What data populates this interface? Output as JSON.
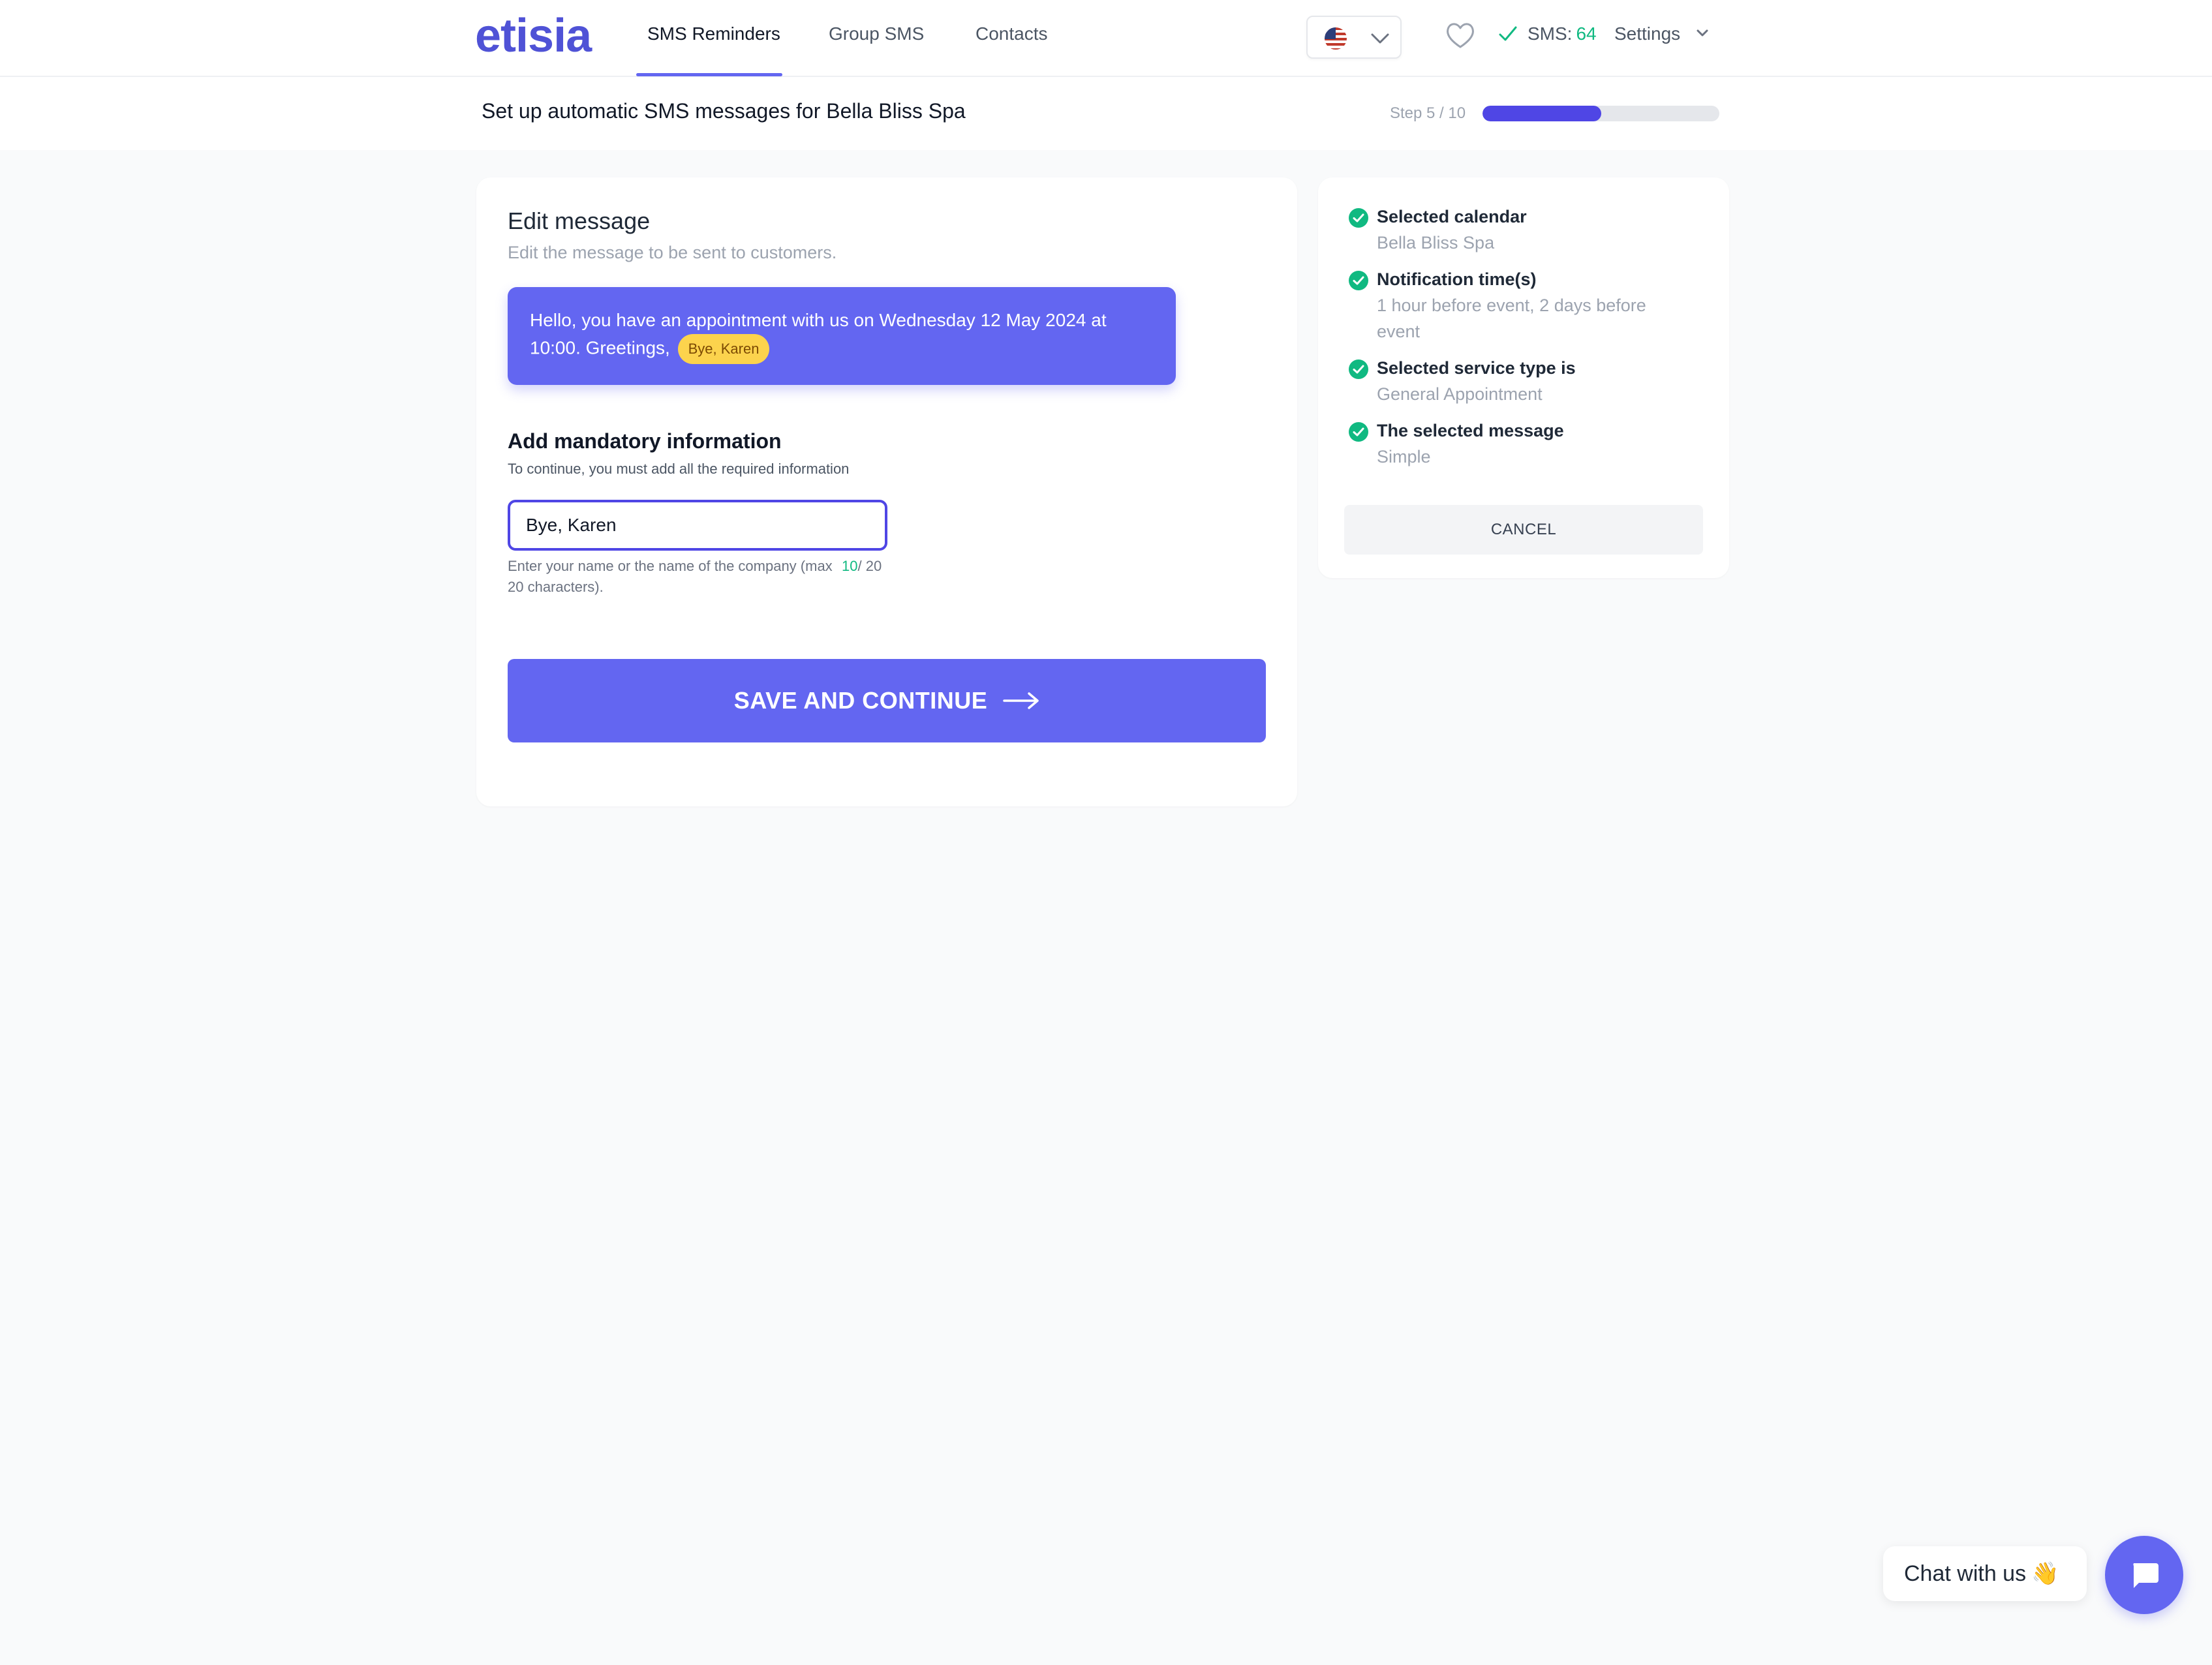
{
  "header": {
    "logo": "etisia",
    "tabs": [
      {
        "label": "SMS Reminders",
        "active": true
      },
      {
        "label": "Group SMS",
        "active": false
      },
      {
        "label": "Contacts",
        "active": false
      }
    ],
    "language_icon": "us-flag-icon",
    "sms_label": "SMS:",
    "sms_count": "64",
    "settings_label": "Settings"
  },
  "subheader": {
    "title": "Set up automatic SMS messages for Bella Bliss Spa",
    "step_label": "Step 5 / 10",
    "progress": 0.5
  },
  "editor": {
    "title": "Edit message",
    "subtitle": "Edit the message to be sent to customers.",
    "preview_text": "Hello, you have an appointment with us on Wednesday 12 May 2024 at 10:00. Greetings,",
    "preview_tag": "Bye, Karen",
    "mandatory_title": "Add mandatory information",
    "mandatory_subtitle": "To continue, you must add all the required information",
    "input_value": "Bye, Karen",
    "input_help": "Enter your name or the name of the company (max 20 characters).",
    "char_current": "10",
    "char_max": "/ 20",
    "save_label": "SAVE AND CONTINUE"
  },
  "summary": {
    "items": [
      {
        "label": "Selected calendar",
        "value": "Bella Bliss Spa"
      },
      {
        "label": "Notification time(s)",
        "value": "1 hour before event, 2 days before event"
      },
      {
        "label": "Selected service type is",
        "value": "General Appointment"
      },
      {
        "label": "The selected message",
        "value": "Simple"
      }
    ],
    "cancel_label": "CANCEL"
  },
  "chat": {
    "label": "Chat with us",
    "emoji": "👋"
  },
  "colors": {
    "brand": "#6366f1",
    "success": "#10b981",
    "highlight": "#fcd34d"
  }
}
